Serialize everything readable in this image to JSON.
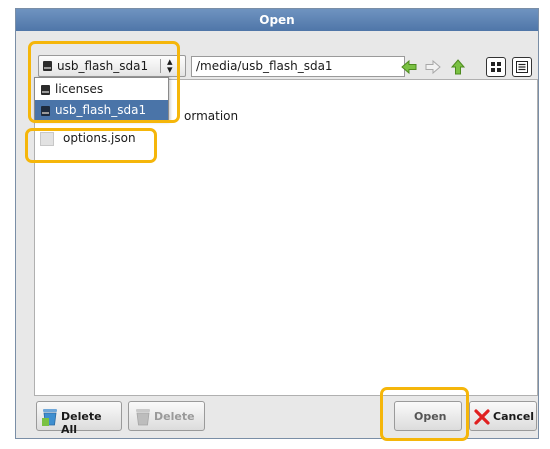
{
  "dialog": {
    "title": "Open"
  },
  "location": {
    "current": "usb_flash_sda1",
    "path": "/media/usb_flash_sda1",
    "options": [
      "licenses",
      "usb_flash_sda1"
    ],
    "selected_index": 1
  },
  "nav": {
    "back_icon": "arrow-left-icon",
    "forward_icon": "arrow-right-icon",
    "up_icon": "arrow-up-icon",
    "icon_view_icon": "grid-view-icon",
    "list_view_icon": "list-view-icon"
  },
  "files": {
    "partially_hidden_text": "ormation",
    "items": [
      {
        "name": "options.json"
      }
    ]
  },
  "buttons": {
    "delete_all": "Delete All",
    "delete": "Delete",
    "open": "Open",
    "cancel": "Cancel"
  },
  "colors": {
    "title_bar": "#5a80b0",
    "selection": "#4a74a8",
    "highlight": "#f5b60a",
    "arrow_green": "#7ac143"
  }
}
